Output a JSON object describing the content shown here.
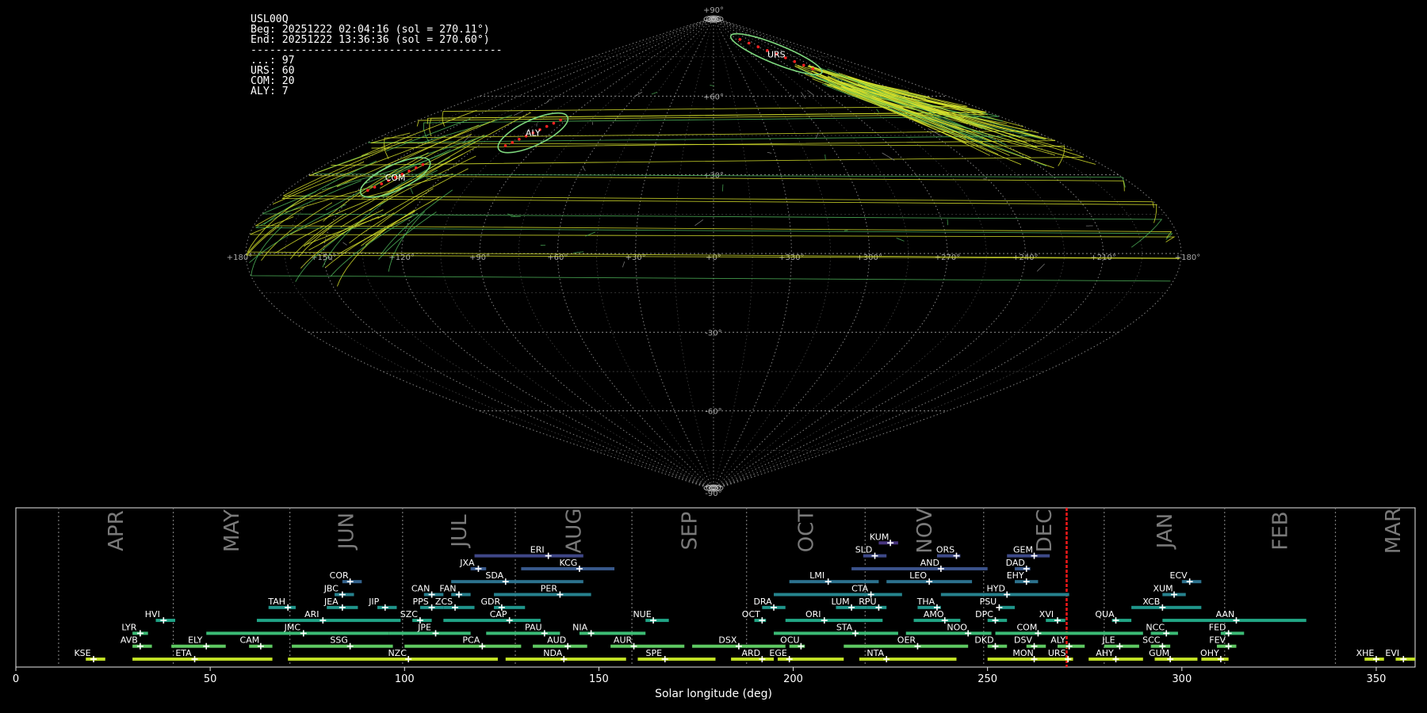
{
  "info": {
    "station": "USL00Q",
    "beg": "Beg: 20251222 02:04:16 (sol = 270.11°)",
    "end": "End: 20251222 13:36:36 (sol = 270.60°)",
    "divider": "----------------------------------------",
    "counts": [
      "...: 97",
      "URS: 60",
      "COM: 20",
      "ALY: 7"
    ]
  },
  "sky": {
    "lon_labels": [
      "+180°",
      "+150°",
      "+120°",
      "+90°",
      "+60°",
      "+30°",
      "+0°",
      "+330°",
      "+300°",
      "+270°",
      "+240°",
      "+210°",
      "+180°"
    ],
    "lat_labels": [
      "+90°",
      "+60°",
      "+30°",
      "-30°",
      "-60°",
      "-90°"
    ],
    "highlights": [
      {
        "code": "URS",
        "lon": -100,
        "lat": 76
      },
      {
        "code": "ALY",
        "lon": 100,
        "lat": 46
      },
      {
        "code": "COM",
        "lon": 140,
        "lat": 29
      }
    ],
    "colors": {
      "grid": "#9a9a9a",
      "highlight_ring": "#7ed87e",
      "points": "#ff2020",
      "tracks_yellow": "#d6e02c",
      "tracks_green": "#4fb55a"
    }
  },
  "chart_data": {
    "type": "timeline",
    "xlabel": "Solar longitude (deg)",
    "xlim": [
      0,
      360
    ],
    "x_ticks": [
      0,
      50,
      100,
      150,
      200,
      250,
      300,
      350
    ],
    "current_sol": 270.35,
    "months": [
      {
        "name": "APR",
        "start": 11,
        "end": 40.5
      },
      {
        "name": "MAY",
        "start": 40.5,
        "end": 70.5
      },
      {
        "name": "JUN",
        "start": 70.5,
        "end": 99.5
      },
      {
        "name": "JUL",
        "start": 99.5,
        "end": 128.5
      },
      {
        "name": "AUG",
        "start": 128.5,
        "end": 158.5
      },
      {
        "name": "SEP",
        "start": 158.5,
        "end": 188
      },
      {
        "name": "OCT",
        "start": 188,
        "end": 218.5
      },
      {
        "name": "NOV",
        "start": 218.5,
        "end": 249
      },
      {
        "name": "DEC",
        "start": 249,
        "end": 280
      },
      {
        "name": "JAN",
        "start": 280,
        "end": 311
      },
      {
        "name": "FEB",
        "start": 311,
        "end": 339.5
      },
      {
        "name": "MAR",
        "start": 339.5,
        "end": 369
      }
    ],
    "showers": [
      {
        "code": "KUM",
        "start": 222,
        "end": 227,
        "peak": 225,
        "row": 9,
        "color": "#46337e"
      },
      {
        "code": "ERI",
        "start": 118,
        "end": 146,
        "peak": 137,
        "row": 8,
        "color": "#3f4788"
      },
      {
        "code": "SLD",
        "start": 218,
        "end": 224,
        "peak": 221,
        "row": 8,
        "color": "#3e4989"
      },
      {
        "code": "ORS",
        "start": 237,
        "end": 243,
        "peak": 242,
        "row": 8,
        "color": "#3e4a89"
      },
      {
        "code": "GEM",
        "start": 255,
        "end": 266,
        "peak": 262,
        "row": 8,
        "color": "#3e4a89"
      },
      {
        "code": "JXA",
        "start": 117,
        "end": 121,
        "peak": 119,
        "row": 7,
        "color": "#38598c"
      },
      {
        "code": "KCG",
        "start": 130,
        "end": 154,
        "peak": 145,
        "row": 7,
        "color": "#38598c"
      },
      {
        "code": "AND",
        "start": 215,
        "end": 250,
        "peak": 238,
        "row": 7,
        "color": "#3b528b"
      },
      {
        "code": "DAD",
        "start": 257,
        "end": 261,
        "peak": 260,
        "row": 7,
        "color": "#38588c"
      },
      {
        "code": "COR",
        "start": 84,
        "end": 89,
        "peak": 86,
        "row": 6,
        "color": "#33638d"
      },
      {
        "code": "SDA",
        "start": 112,
        "end": 146,
        "peak": 126,
        "row": 6,
        "color": "#2c728e"
      },
      {
        "code": "LMI",
        "start": 199,
        "end": 222,
        "peak": 209,
        "row": 6,
        "color": "#2c718e"
      },
      {
        "code": "LEO",
        "start": 224,
        "end": 246,
        "peak": 235,
        "row": 6,
        "color": "#2c718e"
      },
      {
        "code": "EHY",
        "start": 257,
        "end": 263,
        "peak": 260,
        "row": 6,
        "color": "#2c728e"
      },
      {
        "code": "ECV",
        "start": 300,
        "end": 305,
        "peak": 302,
        "row": 6,
        "color": "#2c728e"
      },
      {
        "code": "JBC",
        "start": 82,
        "end": 87,
        "peak": 84,
        "row": 5,
        "color": "#26828e"
      },
      {
        "code": "CAN",
        "start": 105,
        "end": 110,
        "peak": 107,
        "row": 5,
        "color": "#277f8e"
      },
      {
        "code": "FAN",
        "start": 112,
        "end": 117,
        "peak": 114,
        "row": 5,
        "color": "#277f8e"
      },
      {
        "code": "PER",
        "start": 123,
        "end": 148,
        "peak": 140,
        "row": 5,
        "color": "#26818e"
      },
      {
        "code": "CTA",
        "start": 195,
        "end": 228,
        "peak": 220,
        "row": 5,
        "color": "#25858e"
      },
      {
        "code": "HYD",
        "start": 238,
        "end": 271,
        "peak": 255,
        "row": 5,
        "color": "#26828e"
      },
      {
        "code": "XUM",
        "start": 295,
        "end": 301,
        "peak": 298,
        "row": 5,
        "color": "#26828e"
      },
      {
        "code": "TAH",
        "start": 65,
        "end": 72,
        "peak": 70,
        "row": 4,
        "color": "#1f958b"
      },
      {
        "code": "JEA",
        "start": 80,
        "end": 88,
        "peak": 84,
        "row": 4,
        "color": "#1f958b"
      },
      {
        "code": "JIP",
        "start": 93,
        "end": 98,
        "peak": 95,
        "row": 4,
        "color": "#1f958b"
      },
      {
        "code": "PPS",
        "start": 104,
        "end": 110,
        "peak": 107,
        "row": 4,
        "color": "#1f948c"
      },
      {
        "code": "ZCS",
        "start": 110,
        "end": 118,
        "peak": 113,
        "row": 4,
        "color": "#1f948c"
      },
      {
        "code": "GDR",
        "start": 123,
        "end": 131,
        "peak": 125,
        "row": 4,
        "color": "#1f958b"
      },
      {
        "code": "DRA",
        "start": 192,
        "end": 198,
        "peak": 195,
        "row": 4,
        "color": "#1f968b"
      },
      {
        "code": "LUM",
        "start": 211,
        "end": 219,
        "peak": 215,
        "row": 4,
        "color": "#1f968b"
      },
      {
        "code": "RPU",
        "start": 219,
        "end": 224,
        "peak": 222,
        "row": 4,
        "color": "#1f968b"
      },
      {
        "code": "THA",
        "start": 232,
        "end": 238,
        "peak": 237,
        "row": 4,
        "color": "#1f968b"
      },
      {
        "code": "PSU",
        "start": 253,
        "end": 257,
        "peak": 253,
        "row": 4,
        "color": "#1f968b"
      },
      {
        "code": "XCB",
        "start": 287,
        "end": 305,
        "peak": 295,
        "row": 4,
        "color": "#1f968b"
      },
      {
        "code": "HVI",
        "start": 36,
        "end": 41,
        "peak": 38,
        "row": 3,
        "color": "#20a386"
      },
      {
        "code": "ARI",
        "start": 62,
        "end": 99,
        "peak": 79,
        "row": 3,
        "color": "#20a386"
      },
      {
        "code": "SZC",
        "start": 102,
        "end": 107,
        "peak": 104,
        "row": 3,
        "color": "#21a585"
      },
      {
        "code": "CAP",
        "start": 110,
        "end": 135,
        "peak": 127,
        "row": 3,
        "color": "#20a386"
      },
      {
        "code": "NUE",
        "start": 162,
        "end": 168,
        "peak": 164,
        "row": 3,
        "color": "#20a486"
      },
      {
        "code": "OCT",
        "start": 190,
        "end": 193,
        "peak": 192,
        "row": 3,
        "color": "#21a585"
      },
      {
        "code": "ORI",
        "start": 198,
        "end": 223,
        "peak": 208,
        "row": 3,
        "color": "#21a685"
      },
      {
        "code": "AMO",
        "start": 231,
        "end": 243,
        "peak": 239,
        "row": 3,
        "color": "#21a585"
      },
      {
        "code": "DPC",
        "start": 250,
        "end": 255,
        "peak": 252,
        "row": 3,
        "color": "#21a585"
      },
      {
        "code": "XVI",
        "start": 265,
        "end": 270,
        "peak": 268,
        "row": 3,
        "color": "#21a585"
      },
      {
        "code": "QUA",
        "start": 282,
        "end": 287,
        "peak": 283,
        "row": 3,
        "color": "#21a585"
      },
      {
        "code": "AAN",
        "start": 295,
        "end": 332,
        "peak": 314,
        "row": 3,
        "color": "#21a685"
      },
      {
        "code": "LYR",
        "start": 30,
        "end": 34,
        "peak": 32,
        "row": 2,
        "color": "#3bbb75"
      },
      {
        "code": "JMC",
        "start": 49,
        "end": 96,
        "peak": 74,
        "row": 2,
        "color": "#3bbb75"
      },
      {
        "code": "JPE",
        "start": 96,
        "end": 117,
        "peak": 108,
        "row": 2,
        "color": "#3aba76"
      },
      {
        "code": "PAU",
        "start": 121,
        "end": 140,
        "peak": 136,
        "row": 2,
        "color": "#3aba76"
      },
      {
        "code": "NIA",
        "start": 145,
        "end": 162,
        "peak": 148,
        "row": 2,
        "color": "#3dbc74"
      },
      {
        "code": "STA",
        "start": 195,
        "end": 227,
        "peak": 216,
        "row": 2,
        "color": "#3bbb75"
      },
      {
        "code": "NOO",
        "start": 229,
        "end": 251,
        "peak": 245,
        "row": 2,
        "color": "#3bbb75"
      },
      {
        "code": "COM",
        "start": 252,
        "end": 290,
        "peak": 263,
        "row": 2,
        "color": "#3bbb75"
      },
      {
        "code": "NCC",
        "start": 292,
        "end": 299,
        "peak": 296,
        "row": 2,
        "color": "#3bbb75"
      },
      {
        "code": "FED",
        "start": 310,
        "end": 316,
        "peak": 312,
        "row": 2,
        "color": "#3bbb75"
      },
      {
        "code": "AVB",
        "start": 30,
        "end": 35,
        "peak": 32,
        "row": 1,
        "color": "#5ec962"
      },
      {
        "code": "ELY",
        "start": 40,
        "end": 54,
        "peak": 49,
        "row": 1,
        "color": "#5ec962"
      },
      {
        "code": "CAM",
        "start": 60,
        "end": 66,
        "peak": 63,
        "row": 1,
        "color": "#5ec962"
      },
      {
        "code": "SSG",
        "start": 71,
        "end": 97,
        "peak": 86,
        "row": 1,
        "color": "#5ec962"
      },
      {
        "code": "PCA",
        "start": 100,
        "end": 130,
        "peak": 120,
        "row": 1,
        "color": "#60ca60"
      },
      {
        "code": "AUD",
        "start": 133,
        "end": 147,
        "peak": 142,
        "row": 1,
        "color": "#5ec962"
      },
      {
        "code": "AUR",
        "start": 153,
        "end": 172,
        "peak": 159,
        "row": 1,
        "color": "#5ec962"
      },
      {
        "code": "DSX",
        "start": 174,
        "end": 198,
        "peak": 186,
        "row": 1,
        "color": "#5ec962"
      },
      {
        "code": "OCU",
        "start": 199,
        "end": 203,
        "peak": 202,
        "row": 1,
        "color": "#5ec962"
      },
      {
        "code": "OER",
        "start": 213,
        "end": 245,
        "peak": 232,
        "row": 1,
        "color": "#5ec962"
      },
      {
        "code": "DKD",
        "start": 250,
        "end": 255,
        "peak": 252,
        "row": 1,
        "color": "#5ec962"
      },
      {
        "code": "DSV",
        "start": 260,
        "end": 265,
        "peak": 262,
        "row": 1,
        "color": "#5ec962"
      },
      {
        "code": "ALY",
        "start": 268,
        "end": 275,
        "peak": 271,
        "row": 1,
        "color": "#5ec962"
      },
      {
        "code": "JLE",
        "start": 280,
        "end": 289,
        "peak": 284,
        "row": 1,
        "color": "#5ec962"
      },
      {
        "code": "SCC",
        "start": 292,
        "end": 297,
        "peak": 295,
        "row": 1,
        "color": "#5ec962"
      },
      {
        "code": "FEV",
        "start": 309,
        "end": 314,
        "peak": 312,
        "row": 1,
        "color": "#5ec962"
      },
      {
        "code": "KSE",
        "start": 18,
        "end": 23,
        "peak": 20,
        "row": 0,
        "color": "#c0df25"
      },
      {
        "code": "ETA",
        "start": 30,
        "end": 66,
        "peak": 46,
        "row": 0,
        "color": "#c0df25"
      },
      {
        "code": "NZC",
        "start": 70,
        "end": 124,
        "peak": 101,
        "row": 0,
        "color": "#c0df25"
      },
      {
        "code": "NDA",
        "start": 126,
        "end": 157,
        "peak": 141,
        "row": 0,
        "color": "#c0df25"
      },
      {
        "code": "SPE",
        "start": 160,
        "end": 180,
        "peak": 167,
        "row": 0,
        "color": "#c0df25"
      },
      {
        "code": "ARD",
        "start": 184,
        "end": 195,
        "peak": 192,
        "row": 0,
        "color": "#c0df25"
      },
      {
        "code": "EGE",
        "start": 196,
        "end": 213,
        "peak": 199,
        "row": 0,
        "color": "#c0df25"
      },
      {
        "code": "NTA",
        "start": 217,
        "end": 242,
        "peak": 224,
        "row": 0,
        "color": "#c0df25"
      },
      {
        "code": "MON",
        "start": 250,
        "end": 267,
        "peak": 262,
        "row": 0,
        "color": "#c0df25"
      },
      {
        "code": "URS",
        "start": 267,
        "end": 272,
        "peak": 270.7,
        "row": 0,
        "color": "#c0df25"
      },
      {
        "code": "AHY",
        "start": 276,
        "end": 290,
        "peak": 283,
        "row": 0,
        "color": "#c0df25"
      },
      {
        "code": "GUM",
        "start": 293,
        "end": 304,
        "peak": 297,
        "row": 0,
        "color": "#c0df25"
      },
      {
        "code": "OHY",
        "start": 305,
        "end": 312,
        "peak": 310,
        "row": 0,
        "color": "#c0df25"
      },
      {
        "code": "XHE",
        "start": 347,
        "end": 352,
        "peak": 350,
        "row": 0,
        "color": "#c0df25"
      },
      {
        "code": "EVI",
        "start": 355,
        "end": 360,
        "peak": 357,
        "row": 0,
        "color": "#c0df25"
      }
    ]
  }
}
